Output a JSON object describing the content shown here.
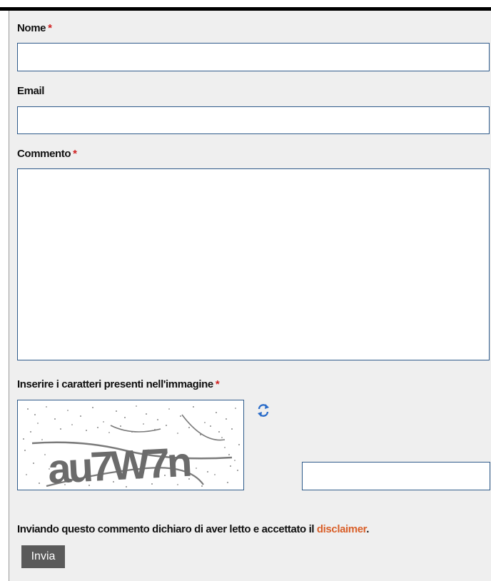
{
  "form": {
    "name_label": "Nome",
    "name_value": "",
    "email_label": "Email",
    "email_value": "",
    "comment_label": "Commento",
    "comment_value": "",
    "captcha_label": "Inserire i caratteri presenti nell'immagine",
    "captcha_text": "au7W7n",
    "captcha_value": "",
    "required_marker": "*",
    "refresh_icon": "refresh-icon",
    "disclaimer_prefix": "Inviando questo commento dichiaro di aver letto e accettato il ",
    "disclaimer_link": "disclaimer",
    "disclaimer_suffix": ".",
    "submit_label": "Invia"
  },
  "colors": {
    "required": "#d02020",
    "link": "#d9602a",
    "input_border": "#2e5a8a",
    "button_bg": "#5a5a5a",
    "panel_bg": "#efefef"
  }
}
